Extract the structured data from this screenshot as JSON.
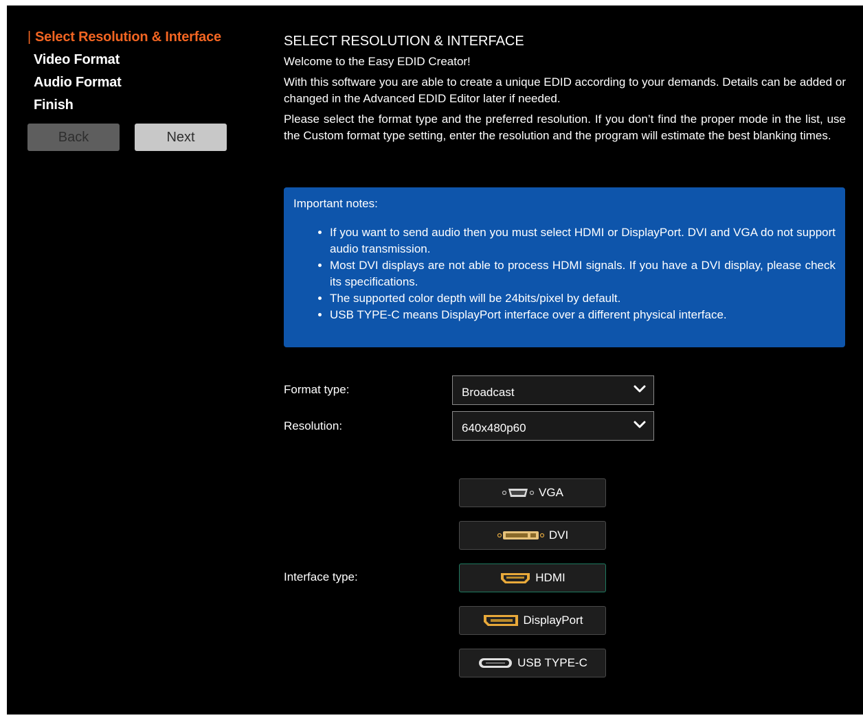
{
  "sidebar": {
    "steps": [
      {
        "label": "Select Resolution & Interface",
        "marker": "|",
        "active": true
      },
      {
        "label": "Video Format"
      },
      {
        "label": "Audio Format"
      },
      {
        "label": "Finish"
      }
    ],
    "back_label": "Back",
    "next_label": "Next"
  },
  "main": {
    "title": "SELECT RESOLUTION & INTERFACE",
    "welcome": "Welcome to the Easy EDID Creator!",
    "intro": "With this software you are able to create a unique EDID according to your demands. Details can be added or changed in the Advanced EDID Editor later if needed.",
    "instructions": "Please select the format type and the preferred resolution. If you don’t find the proper mode in the list, use the Custom format type setting, enter the resolution and the program will estimate the best blanking times."
  },
  "notes": {
    "title": "Important notes:",
    "items": [
      "If you want to send audio then you must select HDMI or DisplayPort. DVI and VGA do not support audio transmission.",
      "Most DVI displays are not able to process HDMI signals. If you have a DVI display, please check its specifications.",
      "The supported color depth will be 24bits/pixel by default.",
      "USB TYPE-C means DisplayPort interface over a different physical interface."
    ]
  },
  "form": {
    "format_type_label": "Format type:",
    "format_type_value": "Broadcast",
    "resolution_label": "Resolution:",
    "resolution_value": "640x480p60",
    "interface_type_label": "Interface type:",
    "interfaces": [
      {
        "label": "VGA",
        "icon": "vga-connector-icon"
      },
      {
        "label": "DVI",
        "icon": "dvi-connector-icon"
      },
      {
        "label": "HDMI",
        "icon": "hdmi-connector-icon",
        "selected": true
      },
      {
        "label": "DisplayPort",
        "icon": "displayport-connector-icon"
      },
      {
        "label": "USB TYPE-C",
        "icon": "usb-c-connector-icon"
      }
    ]
  },
  "colors": {
    "accent": "#f26522",
    "notes_background": "#0e55ab",
    "selected_border": "#1e7a60",
    "background": "#000000"
  }
}
